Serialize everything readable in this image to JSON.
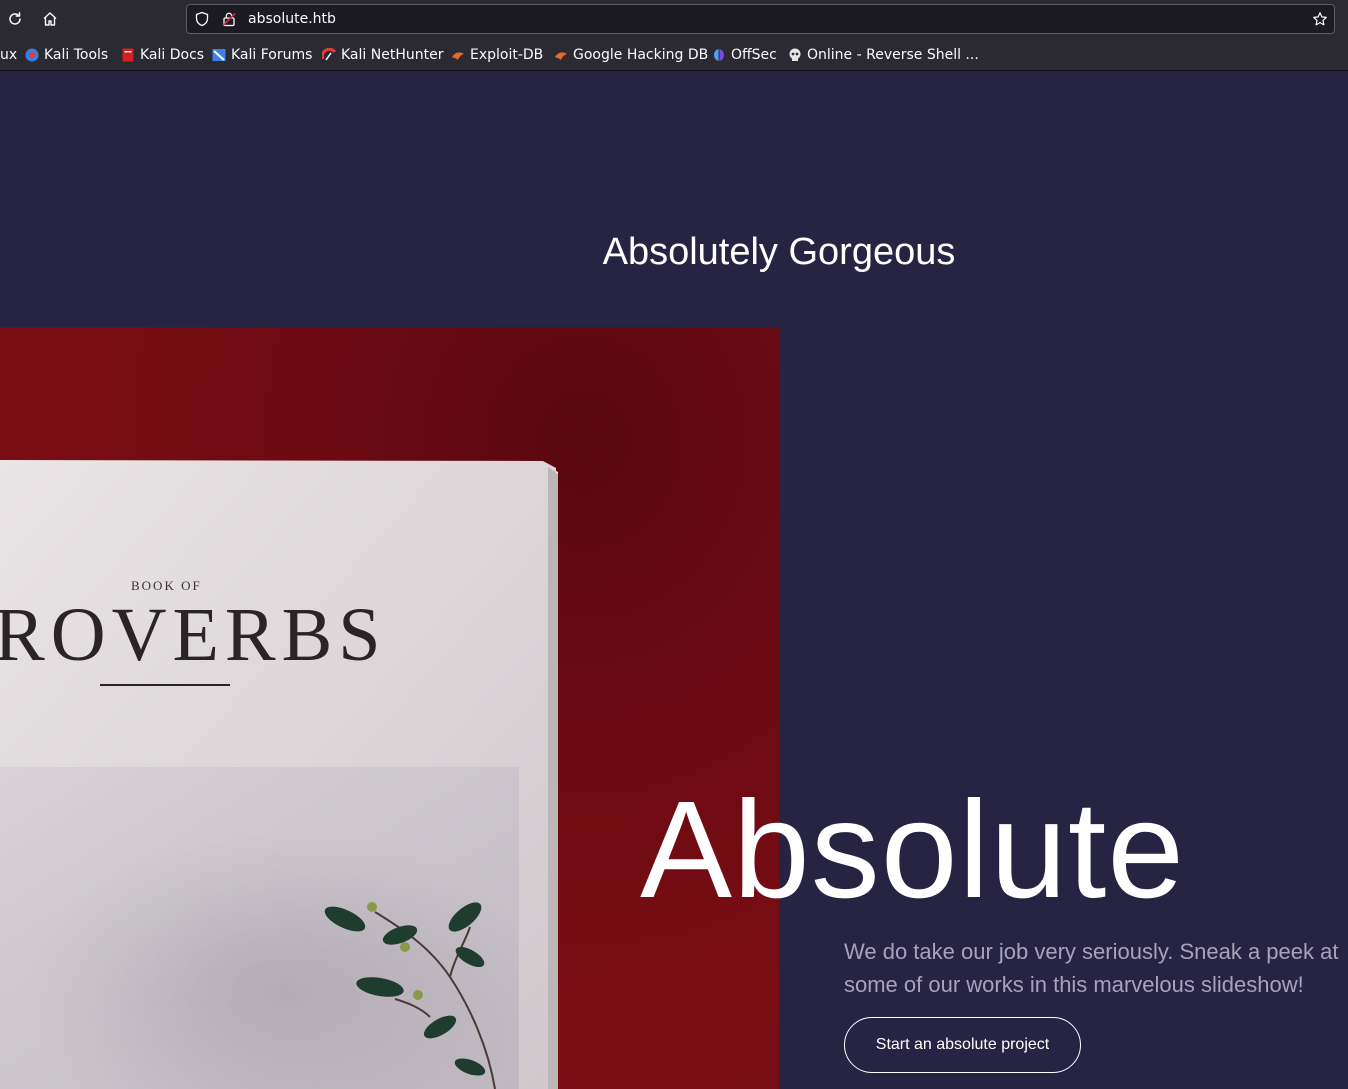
{
  "browser": {
    "url": "absolute.htb",
    "bookmarks": [
      {
        "label": "ux",
        "icon": "bookmark-icon"
      },
      {
        "label": "Kali Tools",
        "icon": "kali-tools-icon"
      },
      {
        "label": "Kali Docs",
        "icon": "kali-docs-icon"
      },
      {
        "label": "Kali Forums",
        "icon": "kali-forums-icon"
      },
      {
        "label": "Kali NetHunter",
        "icon": "kali-nethunter-icon"
      },
      {
        "label": "Exploit-DB",
        "icon": "exploit-db-icon"
      },
      {
        "label": "Google Hacking DB",
        "icon": "ghdb-icon"
      },
      {
        "label": "OffSec",
        "icon": "offsec-icon"
      },
      {
        "label": "Online - Reverse Shell ...",
        "icon": "skull-icon"
      }
    ]
  },
  "hero": {
    "tagline": "Absolutely Gorgeous",
    "title": "Absolute",
    "subtitle": "We do take our job very seriously. Sneak a peek at some of our works in this marvelous slideshow!",
    "cta_label": "Start an absolute project"
  },
  "photo": {
    "kicker": "BOOK OF",
    "title": "ROVERBS"
  },
  "colors": {
    "page_bg": "#272343",
    "chrome_bg": "#2b2a33",
    "photo_red": "#6b0a12",
    "text_muted": "#a7a3b8"
  }
}
